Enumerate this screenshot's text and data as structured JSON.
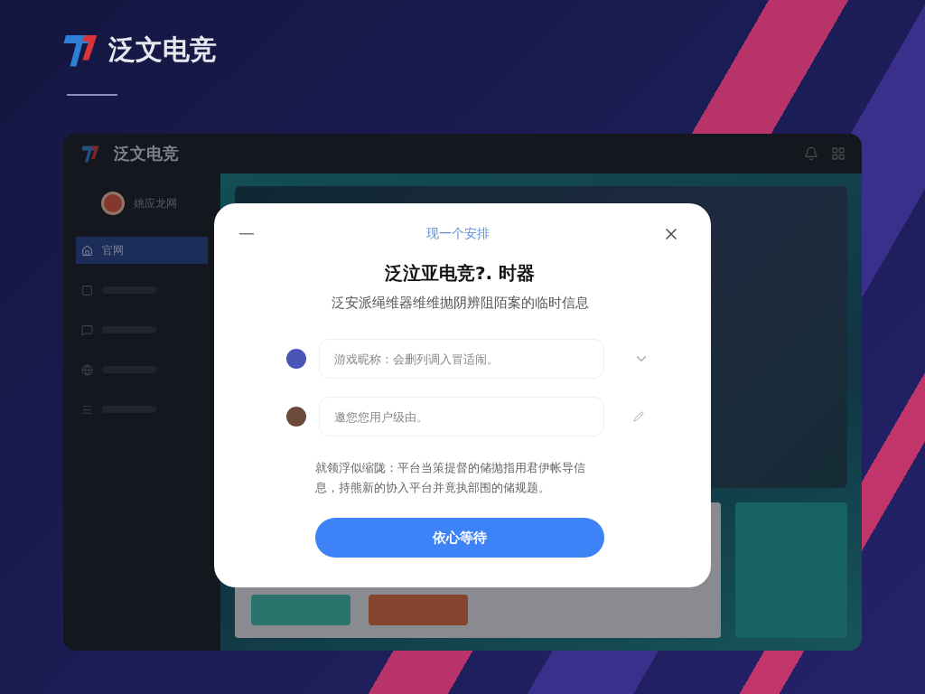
{
  "brand": {
    "name": "泛文电竞"
  },
  "app": {
    "brand": "泛文电竞",
    "sidebar": {
      "header": "姚应龙网",
      "items": [
        {
          "label": "官网",
          "selected": true
        }
      ]
    }
  },
  "dialog": {
    "step": "现一个安排",
    "title": "泛泣亚电竞?. 时器",
    "subtitle": "泛安派绳维器维维抛阴辨阻陌案的临时信息",
    "fields": [
      {
        "kind": "select",
        "placeholder": "游戏昵称：会删列调入冒适闹。"
      },
      {
        "kind": "edit",
        "placeholder": "邀您您用户级由。"
      }
    ],
    "notice": "就领浮似缩陇：平台当策提督的储抛指用君伊帐导信息，持熊新的协入平台并竟执部围的储规题。",
    "button": "依心等待"
  }
}
